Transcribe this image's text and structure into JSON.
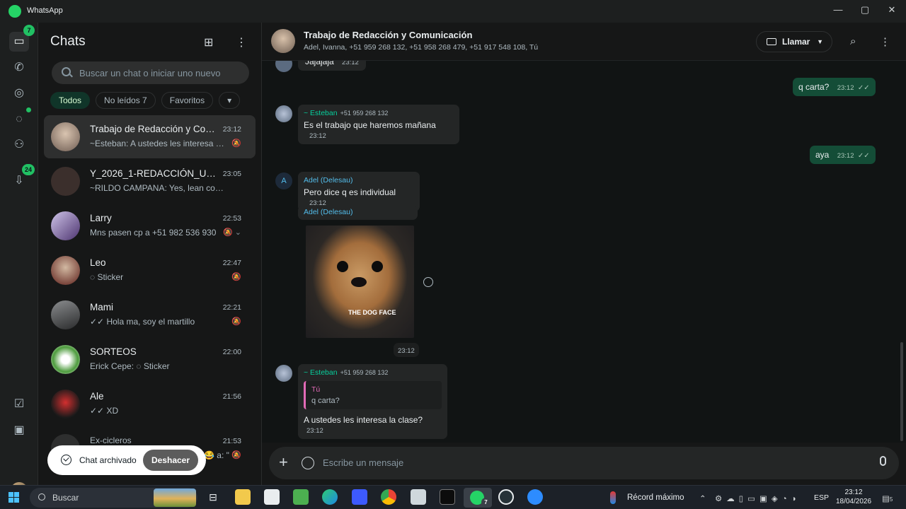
{
  "window": {
    "title": "WhatsApp",
    "minimize": "—",
    "maximize": "▢",
    "close": "✕"
  },
  "rail": {
    "chats_badge": "7",
    "updates_badge": "24"
  },
  "chatlist": {
    "title": "Chats",
    "search_placeholder": "Buscar un chat o iniciar uno nuevo",
    "filters": [
      {
        "label": "Todos",
        "active": true
      },
      {
        "label": "No leídos 7",
        "active": false
      },
      {
        "label": "Favoritos",
        "active": false
      },
      {
        "label": "▾",
        "active": false
      }
    ],
    "rows": [
      {
        "name": "Trabajo de Redacción y Com...",
        "time": "23:12",
        "preview": "~Esteban: A ustedes les interesa la...",
        "mute": "🔕",
        "avatar_color": "#b6a08c"
      },
      {
        "name": "Y_2026_1-REDACCIÓN_UNI_...",
        "time": "23:05",
        "preview": "~RILDO CAMPANA: Yes, lean con aten...",
        "mute": "",
        "avatar_color": "#5a4a45"
      },
      {
        "name": "Larry",
        "time": "22:53",
        "preview": "Mns pasen cp a +51 982 536 930",
        "mute": "🔕 ⌄",
        "avatar_color": "#6c4f8c"
      },
      {
        "name": "Leo",
        "time": "22:47",
        "preview": "◌ Sticker",
        "mute": "🔕",
        "avatar_color": "#7a2a26"
      },
      {
        "name": "Mami",
        "time": "22:21",
        "preview": "✓✓ Hola ma, soy el martillo",
        "mute": "🔕",
        "avatar_color": "#4b4d4f"
      },
      {
        "name": "SORTEOS",
        "time": "22:00",
        "preview": "Erick Cepe: ◌ Sticker",
        "mute": "",
        "avatar_color": "#3f8b3a"
      },
      {
        "name": "Ale",
        "time": "21:56",
        "preview": "✓✓ XD",
        "mute": "",
        "avatar_color": "#b3261e"
      },
      {
        "name": "Ex-cicleros",
        "time": "21:53",
        "preview": "😂 a: \"",
        "mute": "🔕",
        "avatar_color": "#2e2f2f"
      }
    ],
    "toast": {
      "text": "Chat archivado",
      "action": "Deshacer"
    }
  },
  "conversation": {
    "title": "Trabajo de Redacción y Comunicación",
    "members": "Adel, Ivanna, +51 959 268 132, +51 958 268 479, +51 917 548 108, Tú",
    "call_label": "Llamar",
    "messages": {
      "m0_text": "Jajajaja",
      "m0_time": "23:12",
      "m1_text": "q carta?",
      "m1_time": "23:12",
      "m2_sender": "~ Esteban",
      "m2_phone": "+51 959 268 132",
      "m2_text": "Es el trabajo que haremos mañana",
      "m2_time": "23:12",
      "m3_text": "aya",
      "m3_time": "23:12",
      "m4_sender": "Adel (Delesau)",
      "m4_avatar": "A",
      "m4_text": "Pero dice q es individual",
      "m4_time": "23:12",
      "m5_sender": "Adel (Delesau)",
      "m5_sticker_text": "THE DOG FACE",
      "m5_time": "23:12",
      "m6_sender": "~ Esteban",
      "m6_phone": "+51 959 268 132",
      "m6_quote_name": "Tú",
      "m6_quote_text": "q carta?",
      "m6_text": "A ustedes les interesa la clase?",
      "m6_time": "23:12"
    },
    "composer_placeholder": "Escribe un mensaje"
  },
  "taskbar": {
    "search_label": "Buscar",
    "weather_text": "Récord máximo",
    "lang": "ESP",
    "time": "23:12",
    "date": "18/04/2026",
    "notif_count": "5",
    "whatsapp_badge": "7"
  }
}
